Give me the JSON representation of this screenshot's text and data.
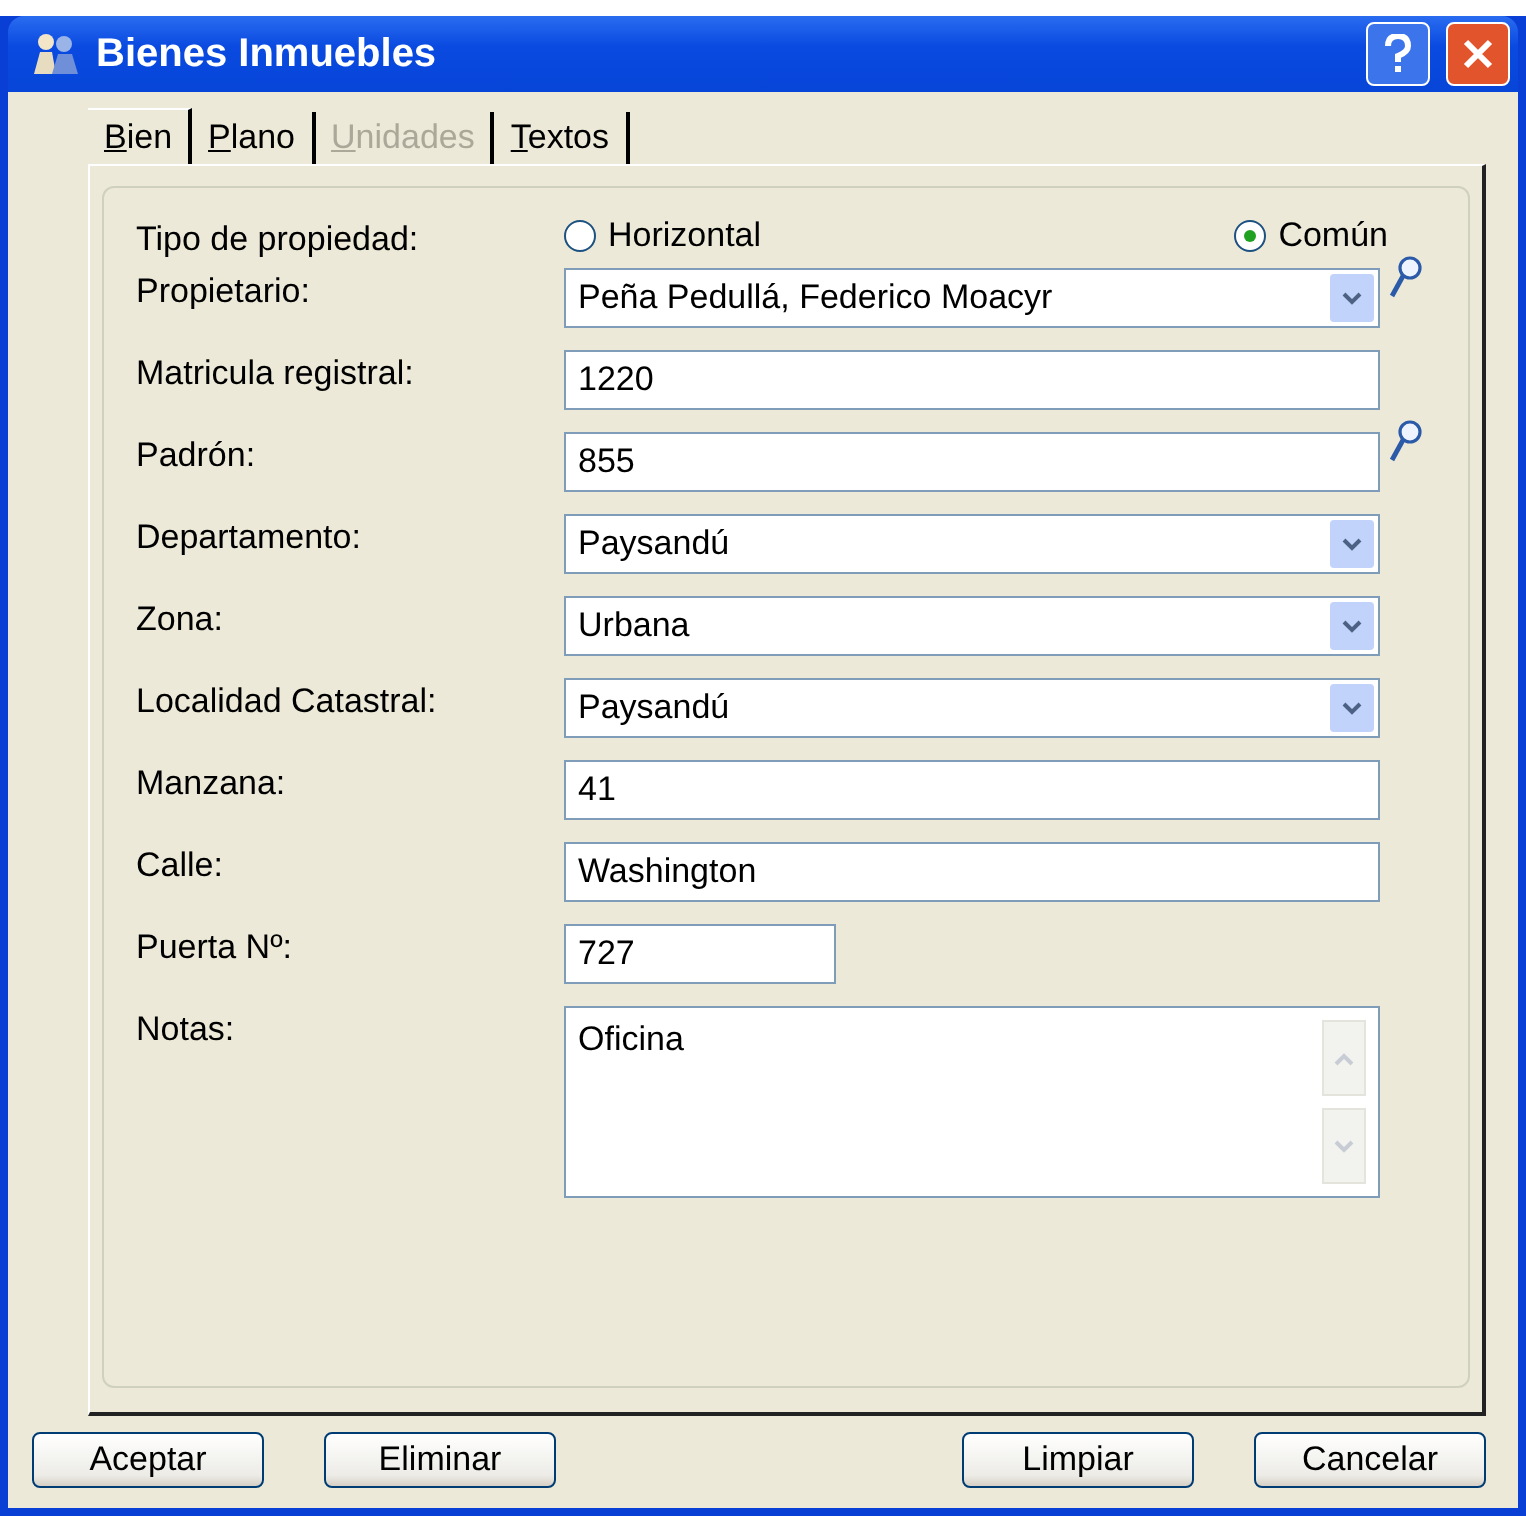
{
  "window": {
    "title": "Bienes Inmuebles"
  },
  "tabs": [
    {
      "label": "Bien",
      "selected": true,
      "disabled": false
    },
    {
      "label": "Plano",
      "selected": false,
      "disabled": false
    },
    {
      "label": "Unidades",
      "selected": false,
      "disabled": true
    },
    {
      "label": "Textos",
      "selected": false,
      "disabled": false
    }
  ],
  "property_type": {
    "label": "Tipo de propiedad:",
    "options": [
      {
        "label": "Horizontal",
        "selected": false
      },
      {
        "label": "Común",
        "selected": true
      }
    ]
  },
  "fields": [
    {
      "label": "Propietario:",
      "value": "Peña Pedullá, Federico Moacyr",
      "kind": "combo",
      "search": true
    },
    {
      "label": "Matricula registral:",
      "value": "1220",
      "kind": "text",
      "search": false
    },
    {
      "label": "Padrón:",
      "value": "855",
      "kind": "text",
      "search": true
    },
    {
      "label": "Departamento:",
      "value": "Paysandú",
      "kind": "combo",
      "search": false
    },
    {
      "label": "Zona:",
      "value": "Urbana",
      "kind": "combo",
      "search": false
    },
    {
      "label": "Localidad Catastral:",
      "value": "Paysandú",
      "kind": "combo",
      "search": false
    },
    {
      "label": "Manzana:",
      "value": "41",
      "kind": "text",
      "search": false
    },
    {
      "label": "Calle:",
      "value": "Washington",
      "kind": "text",
      "search": false
    },
    {
      "label": "Puerta Nº:",
      "value": "727",
      "kind": "short",
      "search": false
    },
    {
      "label": "Notas:",
      "value": "Oficina",
      "kind": "memo",
      "search": false
    }
  ],
  "buttons": [
    "Aceptar",
    "Eliminar",
    "Limpiar",
    "Cancelar"
  ]
}
